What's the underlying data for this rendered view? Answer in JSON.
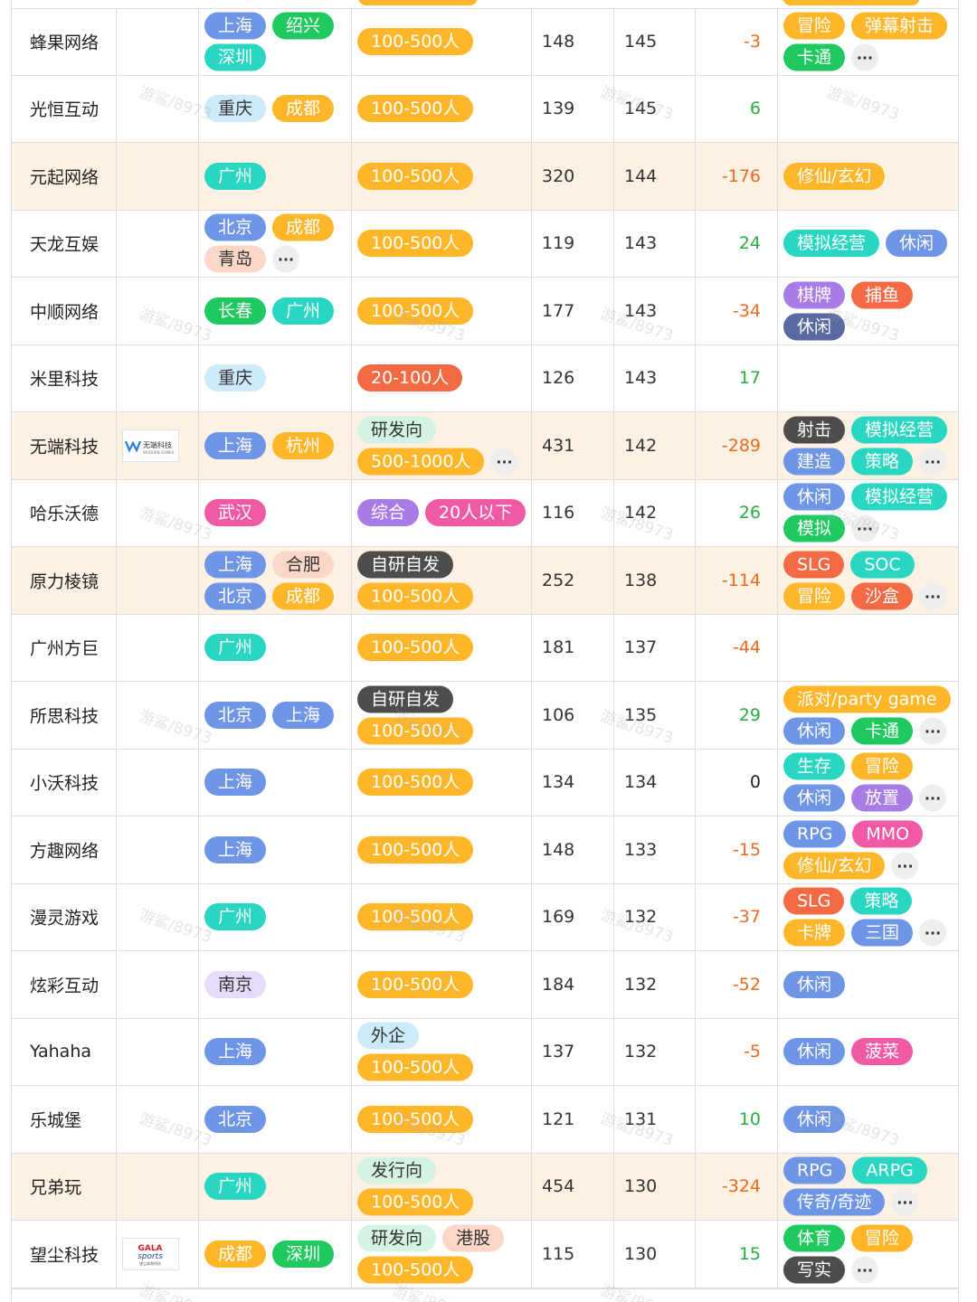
{
  "watermark": "游鲨/8973",
  "more_label": "...",
  "colors": {
    "orange": "#ffb629",
    "teal": "#29d6c2",
    "green": "#1fc95f",
    "blue": "#6f95e6",
    "sky": "#cdeafb",
    "peach": "#fbd7c7",
    "lavender": "#e4dcfa",
    "mint": "#d4f3e4",
    "red": "#f46a45",
    "dark": "#4d4d4d",
    "slate": "#5a6aa0",
    "purple": "#a97be6",
    "hotpink": "#f05aa4",
    "highlight": "#fdf1e4"
  },
  "rows": [
    {
      "name": "蜂果网络",
      "logo": "",
      "cities": [
        {
          "t": "上海",
          "c": "blue"
        },
        {
          "t": "绍兴",
          "c": "green"
        },
        {
          "t": "深圳",
          "c": "teal"
        }
      ],
      "cities_more": false,
      "types": [
        {
          "t": "100-500人",
          "c": "orange"
        }
      ],
      "types_more": false,
      "a": "148",
      "b": "145",
      "diff": "-3",
      "tags": [
        {
          "t": "冒险",
          "c": "orange"
        },
        {
          "t": "弹幕射击",
          "c": "orange"
        },
        {
          "t": "卡通",
          "c": "green"
        }
      ],
      "tags_more": true,
      "hl": false
    },
    {
      "name": "光恒互动",
      "logo": "",
      "cities": [
        {
          "t": "重庆",
          "c": "sky"
        },
        {
          "t": "成都",
          "c": "orange"
        }
      ],
      "cities_more": false,
      "types": [
        {
          "t": "100-500人",
          "c": "orange"
        }
      ],
      "types_more": false,
      "a": "139",
      "b": "145",
      "diff": "6",
      "tags": [],
      "tags_more": false,
      "hl": false
    },
    {
      "name": "元起网络",
      "logo": "",
      "cities": [
        {
          "t": "广州",
          "c": "teal"
        }
      ],
      "cities_more": false,
      "types": [
        {
          "t": "100-500人",
          "c": "orange"
        }
      ],
      "types_more": false,
      "a": "320",
      "b": "144",
      "diff": "-176",
      "tags": [
        {
          "t": "修仙/玄幻",
          "c": "orange"
        }
      ],
      "tags_more": false,
      "hl": true
    },
    {
      "name": "天龙互娱",
      "logo": "",
      "cities": [
        {
          "t": "北京",
          "c": "blue"
        },
        {
          "t": "成都",
          "c": "orange"
        },
        {
          "t": "青岛",
          "c": "peach"
        }
      ],
      "cities_more": true,
      "types": [
        {
          "t": "100-500人",
          "c": "orange"
        }
      ],
      "types_more": false,
      "a": "119",
      "b": "143",
      "diff": "24",
      "tags": [
        {
          "t": "模拟经营",
          "c": "teal"
        },
        {
          "t": "休闲",
          "c": "blue"
        }
      ],
      "tags_more": false,
      "hl": false
    },
    {
      "name": "中顺网络",
      "logo": "",
      "cities": [
        {
          "t": "长春",
          "c": "green"
        },
        {
          "t": "广州",
          "c": "teal"
        }
      ],
      "cities_more": false,
      "types": [
        {
          "t": "100-500人",
          "c": "orange"
        }
      ],
      "types_more": false,
      "a": "177",
      "b": "143",
      "diff": "-34",
      "tags": [
        {
          "t": "棋牌",
          "c": "purple"
        },
        {
          "t": "捕鱼",
          "c": "red"
        },
        {
          "t": "休闲",
          "c": "slate"
        }
      ],
      "tags_more": false,
      "hl": false
    },
    {
      "name": "米里科技",
      "logo": "",
      "cities": [
        {
          "t": "重庆",
          "c": "sky"
        }
      ],
      "cities_more": false,
      "types": [
        {
          "t": "20-100人",
          "c": "red"
        }
      ],
      "types_more": false,
      "a": "126",
      "b": "143",
      "diff": "17",
      "tags": [],
      "tags_more": false,
      "hl": false
    },
    {
      "name": "无端科技",
      "logo": "wuduan",
      "cities": [
        {
          "t": "上海",
          "c": "blue"
        },
        {
          "t": "杭州",
          "c": "orange"
        }
      ],
      "cities_more": false,
      "types": [
        {
          "t": "研发向",
          "c": "mint"
        },
        {
          "t": "500-1000人",
          "c": "orange"
        }
      ],
      "types_more": true,
      "a": "431",
      "b": "142",
      "diff": "-289",
      "tags": [
        {
          "t": "射击",
          "c": "dark"
        },
        {
          "t": "模拟经营",
          "c": "teal"
        },
        {
          "t": "建造",
          "c": "blue"
        },
        {
          "t": "策略",
          "c": "teal"
        }
      ],
      "tags_more": true,
      "hl": true
    },
    {
      "name": "哈乐沃德",
      "logo": "",
      "cities": [
        {
          "t": "武汉",
          "c": "hotpink"
        }
      ],
      "cities_more": false,
      "types": [
        {
          "t": "综合",
          "c": "purple"
        },
        {
          "t": "20人以下",
          "c": "hotpink"
        }
      ],
      "types_more": false,
      "a": "116",
      "b": "142",
      "diff": "26",
      "tags": [
        {
          "t": "休闲",
          "c": "blue"
        },
        {
          "t": "模拟经营",
          "c": "teal"
        },
        {
          "t": "模拟",
          "c": "green"
        }
      ],
      "tags_more": true,
      "hl": false
    },
    {
      "name": "原力棱镜",
      "logo": "",
      "cities": [
        {
          "t": "上海",
          "c": "blue"
        },
        {
          "t": "合肥",
          "c": "peach"
        },
        {
          "t": "北京",
          "c": "blue"
        },
        {
          "t": "成都",
          "c": "orange"
        }
      ],
      "cities_more": false,
      "types": [
        {
          "t": "自研自发",
          "c": "dark"
        },
        {
          "t": "100-500人",
          "c": "orange"
        }
      ],
      "types_more": false,
      "a": "252",
      "b": "138",
      "diff": "-114",
      "tags": [
        {
          "t": "SLG",
          "c": "red"
        },
        {
          "t": "SOC",
          "c": "teal"
        },
        {
          "t": "冒险",
          "c": "orange"
        },
        {
          "t": "沙盒",
          "c": "red"
        }
      ],
      "tags_more": true,
      "hl": true
    },
    {
      "name": "广州方巨",
      "logo": "",
      "cities": [
        {
          "t": "广州",
          "c": "teal"
        }
      ],
      "cities_more": false,
      "types": [
        {
          "t": "100-500人",
          "c": "orange"
        }
      ],
      "types_more": false,
      "a": "181",
      "b": "137",
      "diff": "-44",
      "tags": [],
      "tags_more": false,
      "hl": false
    },
    {
      "name": "所思科技",
      "logo": "",
      "cities": [
        {
          "t": "北京",
          "c": "blue"
        },
        {
          "t": "上海",
          "c": "blue"
        }
      ],
      "cities_more": false,
      "types": [
        {
          "t": "自研自发",
          "c": "dark"
        },
        {
          "t": "100-500人",
          "c": "orange"
        }
      ],
      "types_more": false,
      "a": "106",
      "b": "135",
      "diff": "29",
      "tags": [
        {
          "t": "派对/party game",
          "c": "orange"
        },
        {
          "t": "休闲",
          "c": "blue"
        },
        {
          "t": "卡通",
          "c": "green"
        }
      ],
      "tags_more": true,
      "hl": false
    },
    {
      "name": "小沃科技",
      "logo": "",
      "cities": [
        {
          "t": "上海",
          "c": "blue"
        }
      ],
      "cities_more": false,
      "types": [
        {
          "t": "100-500人",
          "c": "orange"
        }
      ],
      "types_more": false,
      "a": "134",
      "b": "134",
      "diff": "0",
      "tags": [
        {
          "t": "生存",
          "c": "teal"
        },
        {
          "t": "冒险",
          "c": "orange"
        },
        {
          "t": "休闲",
          "c": "blue"
        },
        {
          "t": "放置",
          "c": "purple"
        }
      ],
      "tags_more": true,
      "hl": false
    },
    {
      "name": "方趣网络",
      "logo": "",
      "cities": [
        {
          "t": "上海",
          "c": "blue"
        }
      ],
      "cities_more": false,
      "types": [
        {
          "t": "100-500人",
          "c": "orange"
        }
      ],
      "types_more": false,
      "a": "148",
      "b": "133",
      "diff": "-15",
      "tags": [
        {
          "t": "RPG",
          "c": "blue"
        },
        {
          "t": "MMO",
          "c": "hotpink"
        },
        {
          "t": "修仙/玄幻",
          "c": "orange"
        }
      ],
      "tags_more": true,
      "hl": false
    },
    {
      "name": "漫灵游戏",
      "logo": "",
      "cities": [
        {
          "t": "广州",
          "c": "teal"
        }
      ],
      "cities_more": false,
      "types": [
        {
          "t": "100-500人",
          "c": "orange"
        }
      ],
      "types_more": false,
      "a": "169",
      "b": "132",
      "diff": "-37",
      "tags": [
        {
          "t": "SLG",
          "c": "red"
        },
        {
          "t": "策略",
          "c": "teal"
        },
        {
          "t": "卡牌",
          "c": "orange"
        },
        {
          "t": "三国",
          "c": "blue"
        }
      ],
      "tags_more": true,
      "hl": false
    },
    {
      "name": "炫彩互动",
      "logo": "",
      "cities": [
        {
          "t": "南京",
          "c": "lavender"
        }
      ],
      "cities_more": false,
      "types": [
        {
          "t": "100-500人",
          "c": "orange"
        }
      ],
      "types_more": false,
      "a": "184",
      "b": "132",
      "diff": "-52",
      "tags": [
        {
          "t": "休闲",
          "c": "blue"
        }
      ],
      "tags_more": false,
      "hl": false
    },
    {
      "name": "Yahaha",
      "logo": "",
      "cities": [
        {
          "t": "上海",
          "c": "blue"
        }
      ],
      "cities_more": false,
      "types": [
        {
          "t": "外企",
          "c": "sky"
        },
        {
          "t": "100-500人",
          "c": "orange"
        }
      ],
      "types_more": false,
      "a": "137",
      "b": "132",
      "diff": "-5",
      "tags": [
        {
          "t": "休闲",
          "c": "blue"
        },
        {
          "t": "菠菜",
          "c": "hotpink"
        }
      ],
      "tags_more": false,
      "hl": false
    },
    {
      "name": "乐城堡",
      "logo": "",
      "cities": [
        {
          "t": "北京",
          "c": "blue"
        }
      ],
      "cities_more": false,
      "types": [
        {
          "t": "100-500人",
          "c": "orange"
        }
      ],
      "types_more": false,
      "a": "121",
      "b": "131",
      "diff": "10",
      "tags": [
        {
          "t": "休闲",
          "c": "blue"
        }
      ],
      "tags_more": false,
      "hl": false
    },
    {
      "name": "兄弟玩",
      "logo": "",
      "cities": [
        {
          "t": "广州",
          "c": "teal"
        }
      ],
      "cities_more": false,
      "types": [
        {
          "t": "发行向",
          "c": "mint"
        },
        {
          "t": "100-500人",
          "c": "orange"
        }
      ],
      "types_more": false,
      "a": "454",
      "b": "130",
      "diff": "-324",
      "tags": [
        {
          "t": "RPG",
          "c": "blue"
        },
        {
          "t": "ARPG",
          "c": "teal"
        },
        {
          "t": "传奇/奇迹",
          "c": "blue"
        }
      ],
      "tags_more": true,
      "hl": true
    },
    {
      "name": "望尘科技",
      "logo": "gala",
      "cities": [
        {
          "t": "成都",
          "c": "orange"
        },
        {
          "t": "深圳",
          "c": "green"
        }
      ],
      "cities_more": false,
      "types": [
        {
          "t": "研发向",
          "c": "mint"
        },
        {
          "t": "港股",
          "c": "peach"
        },
        {
          "t": "100-500人",
          "c": "orange"
        }
      ],
      "types_more": false,
      "a": "115",
      "b": "130",
      "diff": "15",
      "tags": [
        {
          "t": "体育",
          "c": "green"
        },
        {
          "t": "冒险",
          "c": "orange"
        },
        {
          "t": "写实",
          "c": "dark"
        }
      ],
      "tags_more": true,
      "hl": false
    }
  ],
  "logos": {
    "wuduan": {
      "text": "无端科技",
      "sub": "WUDUAN GAMES"
    },
    "gala": {
      "text": "GALA sports",
      "sub": "望尘体育科技"
    }
  }
}
